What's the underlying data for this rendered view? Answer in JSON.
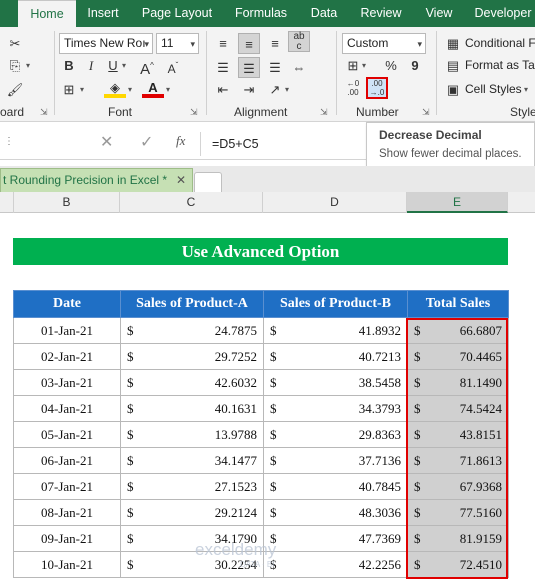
{
  "ribbon_tabs": [
    "Home",
    "Insert",
    "Page Layout",
    "Formulas",
    "Data",
    "Review",
    "View",
    "Developer"
  ],
  "font": {
    "name": "Times New Roı",
    "size": "11",
    "group_label": "Font"
  },
  "clipboard_label": "oard",
  "alignment_label": "Alignment",
  "number": {
    "format": "Custom",
    "group_label": "Number",
    "currency_symbol": "$",
    "percent": "%",
    "comma": "9"
  },
  "styles": {
    "conditional": "Conditional Fo",
    "format_table": "Format as Tab",
    "cell_styles": "Cell Styles",
    "group_label": "Style"
  },
  "tooltip": {
    "title": "Decrease Decimal",
    "desc": "Show fewer decimal places."
  },
  "formula_bar": {
    "fx": "fx",
    "formula": "=D5+C5"
  },
  "workbook_tab": "t Rounding Precision in Excel *",
  "columns": [
    "B",
    "C",
    "D",
    "E"
  ],
  "banner": "Use Advanced Option",
  "table": {
    "headers": [
      "Date",
      "Sales of Product-A",
      "Sales of Product-B",
      "Total Sales"
    ],
    "currency": "$",
    "rows": [
      {
        "date": "01-Jan-21",
        "a": "24.7875",
        "b": "41.8932",
        "t": "66.6807"
      },
      {
        "date": "02-Jan-21",
        "a": "29.7252",
        "b": "40.7213",
        "t": "70.4465"
      },
      {
        "date": "03-Jan-21",
        "a": "42.6032",
        "b": "38.5458",
        "t": "81.1490"
      },
      {
        "date": "04-Jan-21",
        "a": "40.1631",
        "b": "34.3793",
        "t": "74.5424"
      },
      {
        "date": "05-Jan-21",
        "a": "13.9788",
        "b": "29.8363",
        "t": "43.8151"
      },
      {
        "date": "06-Jan-21",
        "a": "34.1477",
        "b": "37.7136",
        "t": "71.8613"
      },
      {
        "date": "07-Jan-21",
        "a": "27.1523",
        "b": "40.7845",
        "t": "67.9368"
      },
      {
        "date": "08-Jan-21",
        "a": "29.2124",
        "b": "48.3036",
        "t": "77.5160"
      },
      {
        "date": "09-Jan-21",
        "a": "34.1790",
        "b": "47.7369",
        "t": "81.9159"
      },
      {
        "date": "10-Jan-21",
        "a": "30.2254",
        "b": "42.2256",
        "t": "72.4510"
      }
    ]
  },
  "watermark": "exceldemy",
  "watermark_sub": "DATA · BI",
  "colors": {
    "excel_green": "#217346",
    "banner_green": "#00b050",
    "header_blue": "#1f6fc5",
    "highlight_red": "#e00000"
  }
}
